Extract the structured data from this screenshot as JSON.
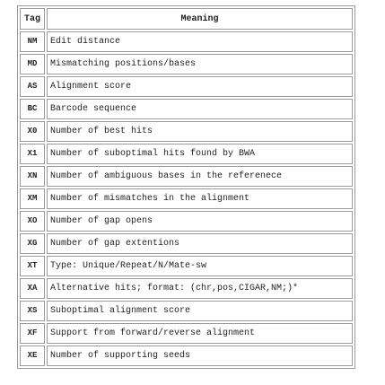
{
  "table": {
    "headers": {
      "tag": "Tag",
      "meaning": "Meaning"
    },
    "rows": [
      {
        "tag": "NM",
        "meaning": "Edit distance"
      },
      {
        "tag": "MD",
        "meaning": "Mismatching positions/bases"
      },
      {
        "tag": "AS",
        "meaning": "Alignment score"
      },
      {
        "tag": "BC",
        "meaning": "Barcode sequence"
      },
      {
        "tag": "X0",
        "meaning": "Number of best hits"
      },
      {
        "tag": "X1",
        "meaning": "Number of suboptimal hits found by BWA"
      },
      {
        "tag": "XN",
        "meaning": "Number of ambiguous bases in the referenece"
      },
      {
        "tag": "XM",
        "meaning": "Number of mismatches in the alignment"
      },
      {
        "tag": "XO",
        "meaning": "Number of gap opens"
      },
      {
        "tag": "XG",
        "meaning": "Number of gap extentions"
      },
      {
        "tag": "XT",
        "meaning": "Type: Unique/Repeat/N/Mate-sw"
      },
      {
        "tag": "XA",
        "meaning": "Alternative hits; format: (chr,pos,CIGAR,NM;)*"
      },
      {
        "tag": "XS",
        "meaning": "Suboptimal alignment score"
      },
      {
        "tag": "XF",
        "meaning": "Support from forward/reverse alignment"
      },
      {
        "tag": "XE",
        "meaning": "Number of supporting seeds"
      }
    ]
  }
}
